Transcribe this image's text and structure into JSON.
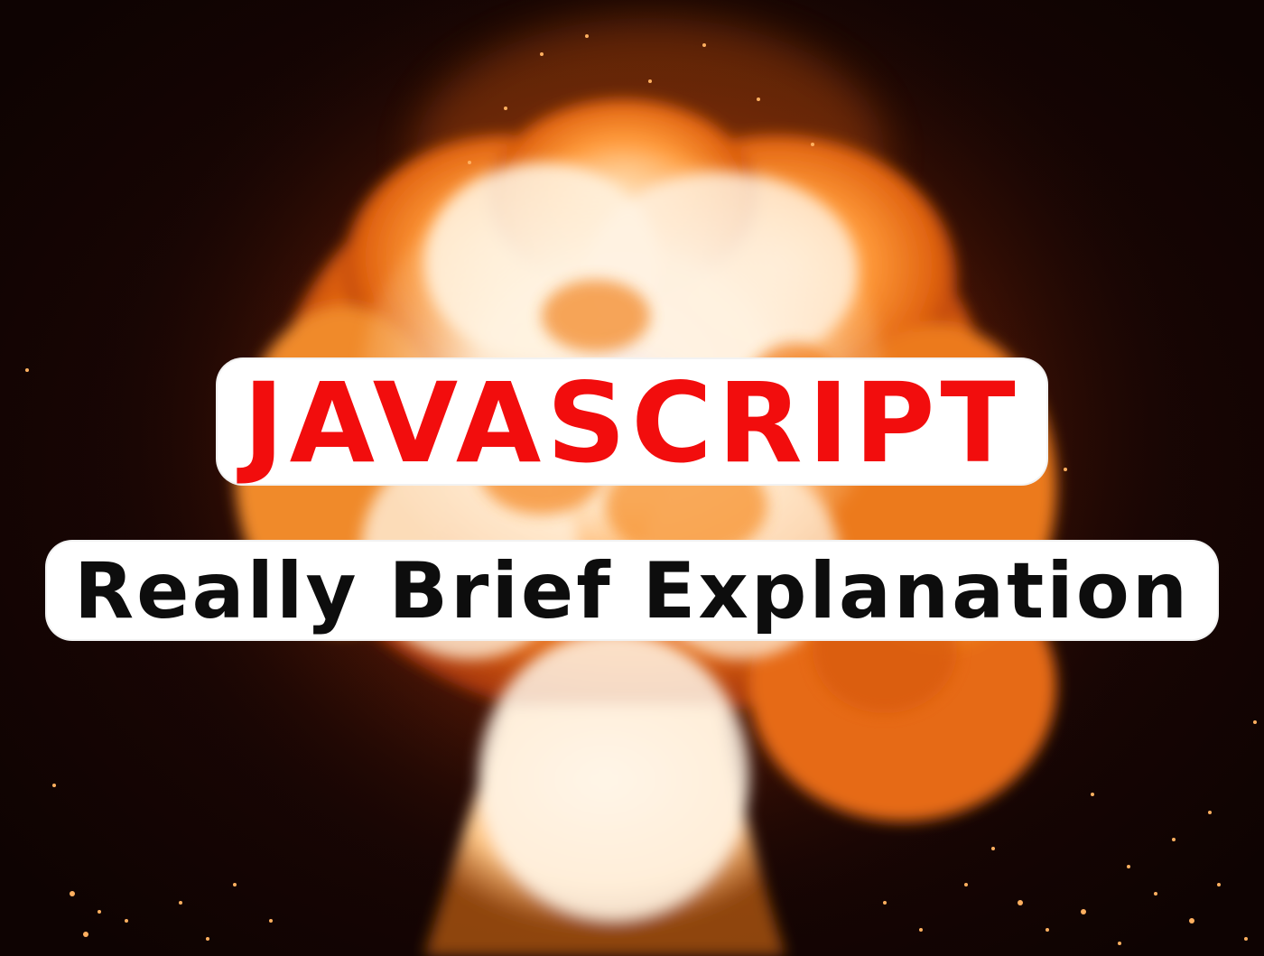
{
  "image": {
    "subject": "fireball-explosion",
    "colors": {
      "background": "#120403",
      "flame_core": "#fff4e8",
      "flame_orange": "#f07818",
      "flame_deep": "#c4420a",
      "title_red": "#f20d0d",
      "subtitle_black": "#0d0d0d",
      "label_bg": "#ffffff"
    }
  },
  "title": {
    "main": "JAVASCRIPT",
    "subtitle": "Really Brief Explanation"
  }
}
